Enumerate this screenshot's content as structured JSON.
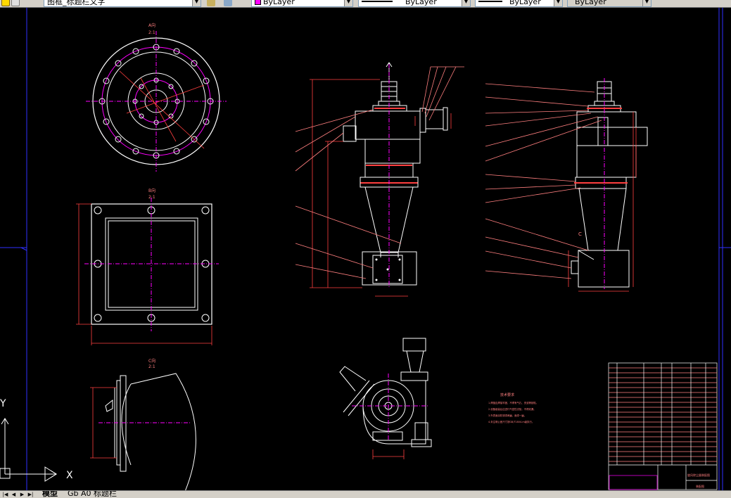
{
  "toolbar": {
    "text_style": "图框_标题栏文字",
    "color_combo": "ByLayer",
    "linetype_combo": "ByLayer",
    "lineweight_combo": "ByLayer",
    "plotstyle_combo": "ByLayer",
    "color_swatch": "#ff00ff"
  },
  "tabs": [
    {
      "label": "模型"
    },
    {
      "label": "Gb A0 标题栏"
    }
  ],
  "ucs": {
    "y_label": "Y",
    "x_label": "X"
  },
  "views": {
    "view_a_label": "A向",
    "view_a_scale": "2:1",
    "view_b_label": "B向",
    "view_b_scale": "2:1",
    "view_c_label": "C向",
    "view_c_scale": "2:1",
    "section_mark": "C"
  },
  "notes": {
    "title": "技术要求",
    "lines": [
      "1.焊缝应焊接牢固，不得有气孔、夹渣等缺陷。",
      "2.设备组装后应进行气密性试验，不得泄漏。",
      "3.外表面涂防锈漆两遍，面漆一遍。",
      "4.未注明公差尺寸按GB/T1804-m级执行。"
    ]
  },
  "title_block": {
    "drawing_name": "旋风除尘器装配图",
    "sheet_label": "装配图"
  },
  "colors": {
    "background": "#000000",
    "outline": "#ffffff",
    "dimension": "#ff3f3f",
    "centerline": "#ff00ff",
    "frame": "#0000ff",
    "leader": "#ff7f7f"
  }
}
